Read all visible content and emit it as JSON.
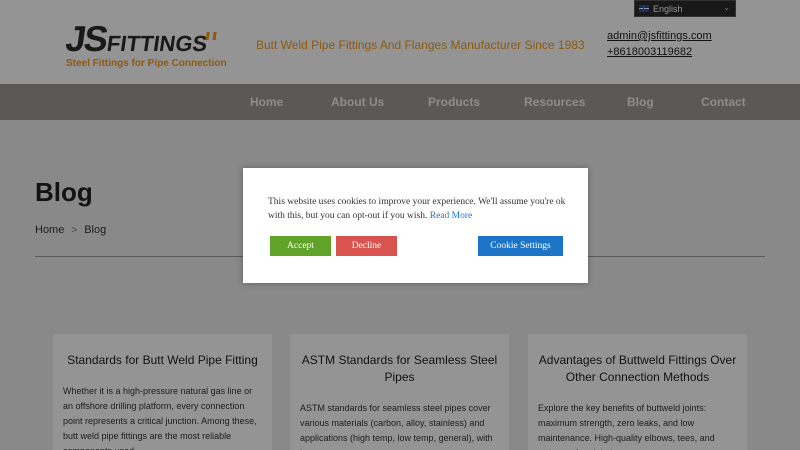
{
  "header": {
    "logo_js": "JS",
    "logo_fittings": "FITTINGS",
    "logo_tagline": "Steel Fittings for Pipe Connection",
    "tagline": "Butt Weld Pipe Fittings And Flanges Manufacturer Since 1983",
    "email": "admin@jsfittings.com",
    "phone": "+8618003119682",
    "language": "English"
  },
  "nav": {
    "items": [
      {
        "label": "Home"
      },
      {
        "label": "About Us"
      },
      {
        "label": "Products"
      },
      {
        "label": "Resources"
      },
      {
        "label": "Blog"
      },
      {
        "label": "Contact"
      }
    ]
  },
  "page": {
    "title": "Blog",
    "breadcrumb": [
      "Home",
      "Blog"
    ],
    "breadcrumb_sep": ">"
  },
  "cards": [
    {
      "title": "Standards for Butt Weld Pipe Fitting",
      "body": "Whether it is a high-pressure natural gas line or an offshore drilling platform, every connection point represents a critical junction. Among these, butt weld pipe fittings are the most reliable components used"
    },
    {
      "title": "ASTM Standards for Seamless Steel Pipes",
      "body": "ASTM standards for seamless steel pipes cover various materials (carbon, alloy, stainless) and applications (high temp, low temp, general), with key"
    },
    {
      "title": "Advantages of Buttweld Fittings Over Other Connection Methods",
      "body": "Explore the key benefits of buttweld joints: maximum strength, zero leaks, and low maintenance. High-quality elbows, tees, and reducers for global"
    }
  ],
  "cookie": {
    "message": "This website uses cookies to improve your experience. We'll assume you're ok with this, but you can opt-out if you wish.",
    "read_more": "Read More",
    "accept": "Accept",
    "decline": "Decline",
    "settings": "Cookie Settings"
  }
}
